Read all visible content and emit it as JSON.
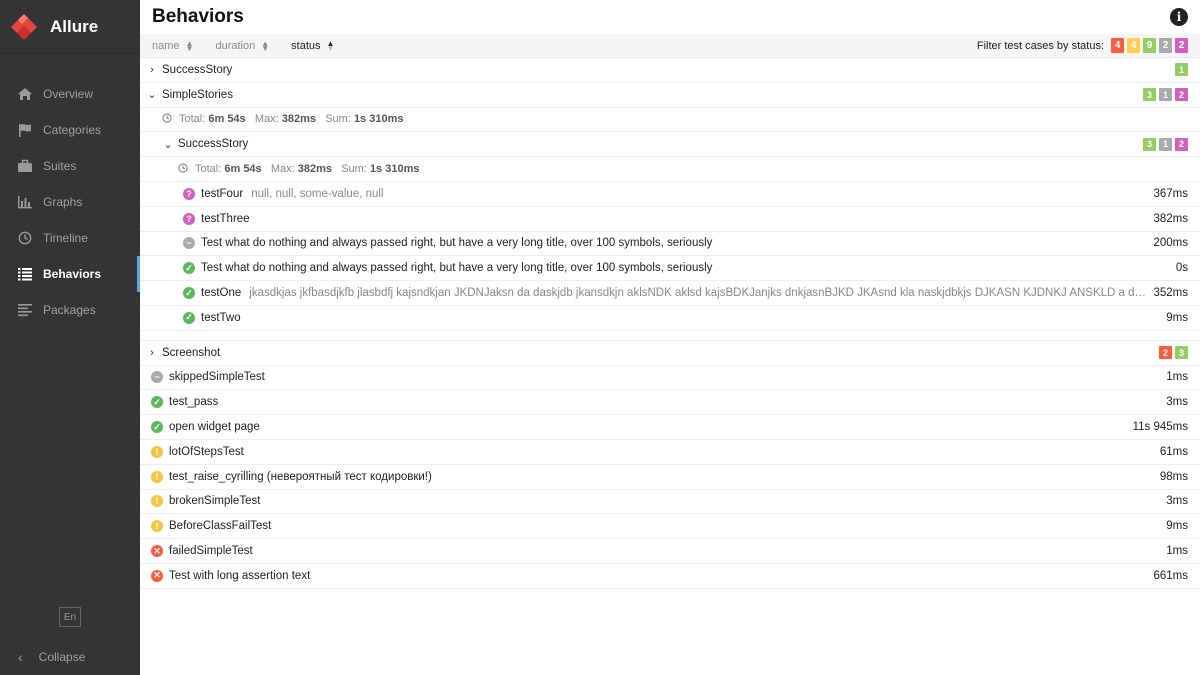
{
  "app": {
    "name": "Allure"
  },
  "nav": [
    {
      "label": "Overview",
      "icon": "home-icon"
    },
    {
      "label": "Categories",
      "icon": "flag-icon"
    },
    {
      "label": "Suites",
      "icon": "briefcase-icon"
    },
    {
      "label": "Graphs",
      "icon": "bar-chart-icon"
    },
    {
      "label": "Timeline",
      "icon": "clock-icon"
    },
    {
      "label": "Behaviors",
      "icon": "list-icon",
      "active": true
    },
    {
      "label": "Packages",
      "icon": "align-left-icon"
    }
  ],
  "lang": "En",
  "collapse_label": "Collapse",
  "page_title": "Behaviors",
  "sort": {
    "name": "name",
    "duration": "duration",
    "status": "status"
  },
  "filter": {
    "label": "Filter test cases by status:",
    "counts": [
      "4",
      "4",
      "9",
      "2",
      "2"
    ]
  },
  "colors": {
    "failed": "#fd5a3e",
    "broken": "#ffd050",
    "passed": "#97cc64",
    "skipped": "#aaaaaa",
    "unknown": "#d35ebe",
    "sidebar": "#343434"
  },
  "groups": {
    "success_story": {
      "name": "SuccessStory",
      "counts": [
        "1"
      ]
    },
    "simple_stories": {
      "name": "SimpleStories",
      "counts": [
        "3",
        "1",
        "2"
      ],
      "stats": {
        "total_label": "Total:",
        "total": "6m 54s",
        "max_label": "Max:",
        "max": "382ms",
        "sum_label": "Sum:",
        "sum": "1s 310ms"
      },
      "child": {
        "name": "SuccessStory",
        "counts": [
          "3",
          "1",
          "2"
        ],
        "stats": {
          "total_label": "Total:",
          "total": "6m 54s",
          "max_label": "Max:",
          "max": "382ms",
          "sum_label": "Sum:",
          "sum": "1s 310ms"
        },
        "tests": [
          {
            "name": "testFour",
            "params": "null, null, some-value, null",
            "duration": "367ms",
            "status": "unknown"
          },
          {
            "name": "testThree",
            "params": "",
            "duration": "382ms",
            "status": "unknown"
          },
          {
            "name": "Test what do nothing and always passed right, but have a very long title, over 100 symbols, seriously",
            "params": "",
            "duration": "200ms",
            "status": "skipped"
          },
          {
            "name": "Test what do nothing and always passed right, but have a very long title, over 100 symbols, seriously",
            "params": "",
            "duration": "0s",
            "status": "passed"
          },
          {
            "name": "testOne",
            "params": "jkasdkjas jkfbasdjkfb jlasbdfj kajsndkjan JKDNJaksn da daskjdb jkansdkjn aklsNDK aklsd kajsBDKJanjks dnkjasnBJKD JKAsnd kla naskjdbkjs DJKASN KJDNKJ ANSKLD a dsdnfkjsdnJF...",
            "duration": "352ms",
            "status": "passed"
          },
          {
            "name": "testTwo",
            "params": "",
            "duration": "9ms",
            "status": "passed"
          }
        ]
      }
    },
    "screenshot": {
      "name": "Screenshot",
      "counts": [
        "2",
        "3"
      ]
    }
  },
  "tests": [
    {
      "name": "skippedSimpleTest",
      "duration": "1ms",
      "status": "skipped"
    },
    {
      "name": "test_pass",
      "duration": "3ms",
      "status": "passed"
    },
    {
      "name": "open widget page",
      "duration": "11s 945ms",
      "status": "passed"
    },
    {
      "name": "lotOfStepsTest",
      "duration": "61ms",
      "status": "broken"
    },
    {
      "name": "test_raise_cyrilling (невероятный тест кодировки!)",
      "duration": "98ms",
      "status": "broken"
    },
    {
      "name": "brokenSimpleTest",
      "duration": "3ms",
      "status": "broken"
    },
    {
      "name": "BeforeClassFailTest",
      "duration": "9ms",
      "status": "broken"
    },
    {
      "name": "failedSimpleTest",
      "duration": "1ms",
      "status": "failed"
    },
    {
      "name": "Test with long assertion text",
      "duration": "661ms",
      "status": "failed"
    }
  ]
}
